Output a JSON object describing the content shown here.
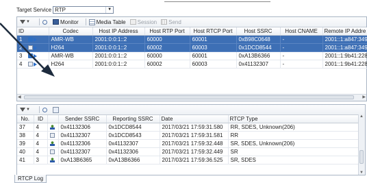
{
  "target": {
    "label": "Target Service",
    "value": "RTP"
  },
  "toolbar": {
    "monitor": "Monitor",
    "media_table": "Media Table",
    "session": "Session",
    "send": "Send"
  },
  "top_table": {
    "headers": [
      "ID",
      "Codec",
      "Host IP Address",
      "Host RTP Port",
      "Host RTCP Port",
      "Host SSRC",
      "Host CNAME",
      "Remote IP Addre"
    ],
    "rows": [
      {
        "id": "1",
        "codec": "AMR-WB",
        "ip": "2001:0:0:1::2",
        "rtp": "60000",
        "rtcp": "60001",
        "ssrc": "0xB98C0648",
        "cname": "-",
        "remote": "2001::1:a847:349",
        "selected": true
      },
      {
        "id": "2",
        "codec": "H264",
        "ip": "2001:0:0:1::2",
        "rtp": "60002",
        "rtcp": "60003",
        "ssrc": "0x1DCD8544",
        "cname": "-",
        "remote": "2001::1:a847:349",
        "selected": true
      },
      {
        "id": "3",
        "codec": "AMR-WB",
        "ip": "2001:0:0:1::2",
        "rtp": "60000",
        "rtcp": "60001",
        "ssrc": "0xA13B6366",
        "cname": "-",
        "remote": "2001::1:9b41:228",
        "selected": false
      },
      {
        "id": "4",
        "codec": "H264",
        "ip": "2001:0:0:1::2",
        "rtp": "60002",
        "rtcp": "60003",
        "ssrc": "0x41132307",
        "cname": "-",
        "remote": "2001::1:9b41:228",
        "selected": false
      }
    ]
  },
  "bottom_table": {
    "headers": [
      "No.",
      "ID",
      "",
      "Sender SSRC",
      "Reporting SSRC",
      "Date",
      "RTCP Type"
    ],
    "rows": [
      {
        "no": "37",
        "id": "4",
        "sender": "0x41132306",
        "reporting": "0x1DCD8544",
        "date": "2017/03/21 17:59:31.580",
        "type": "RR, SDES, Unknown(206)",
        "icon": "person"
      },
      {
        "no": "38",
        "id": "4",
        "sender": "0x41132307",
        "reporting": "0x1DCD8543",
        "date": "2017/03/21 17:59:31.581",
        "type": "RR",
        "icon": "doc"
      },
      {
        "no": "39",
        "id": "4",
        "sender": "0x41132306",
        "reporting": "0x41132307",
        "date": "2017/03/21 17:59:32.448",
        "type": "SR, SDES, Unknown(206)",
        "icon": "person"
      },
      {
        "no": "40",
        "id": "4",
        "sender": "0x41132307",
        "reporting": "0x41132306",
        "date": "2017/03/21 17:59:32.449",
        "type": "SR",
        "icon": "doc"
      },
      {
        "no": "41",
        "id": "3",
        "sender": "0xA13B6365",
        "reporting": "0xA13B6366",
        "date": "2017/03/21 17:59:36.525",
        "type": "SR, SDES",
        "icon": "person"
      }
    ]
  },
  "tab": {
    "label": "RTCP Log"
  }
}
